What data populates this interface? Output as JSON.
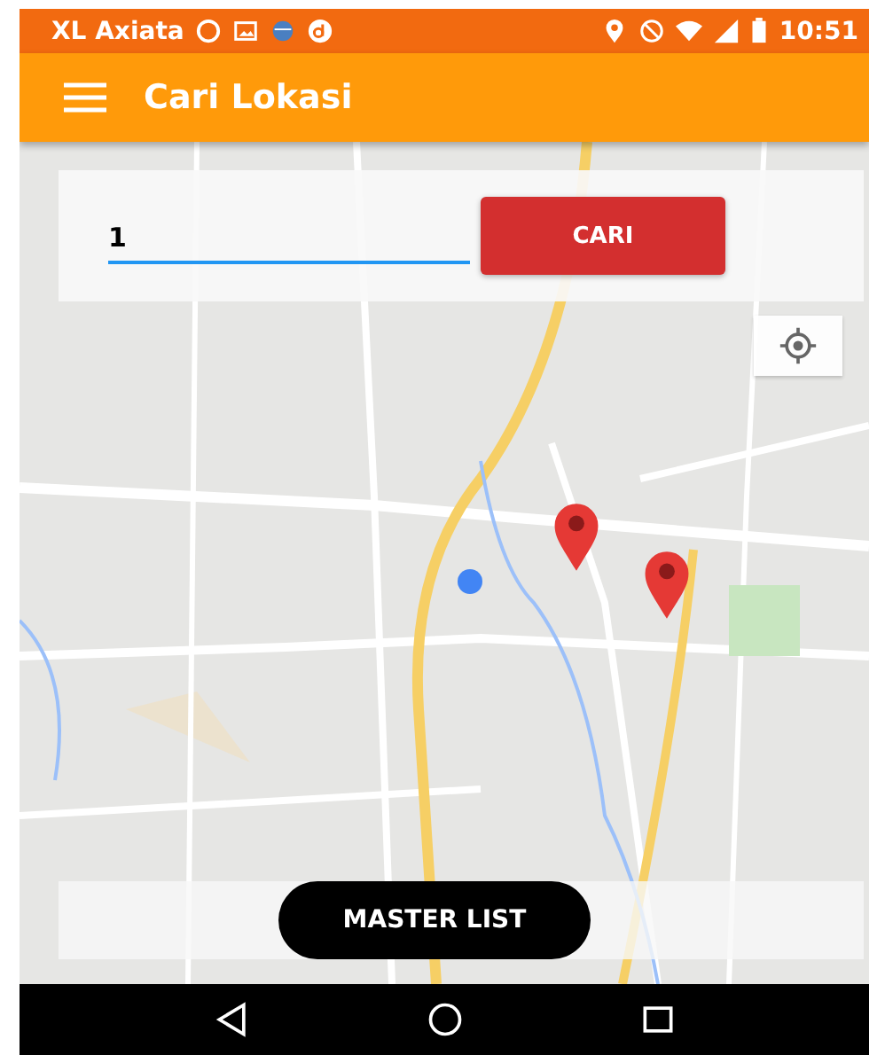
{
  "status_bar": {
    "carrier": "XL Axiata",
    "time": "10:51"
  },
  "app_bar": {
    "title": "Cari Lokasi"
  },
  "search": {
    "value": "1",
    "button": "CARI"
  },
  "bottom": {
    "button": "MASTER LIST"
  }
}
